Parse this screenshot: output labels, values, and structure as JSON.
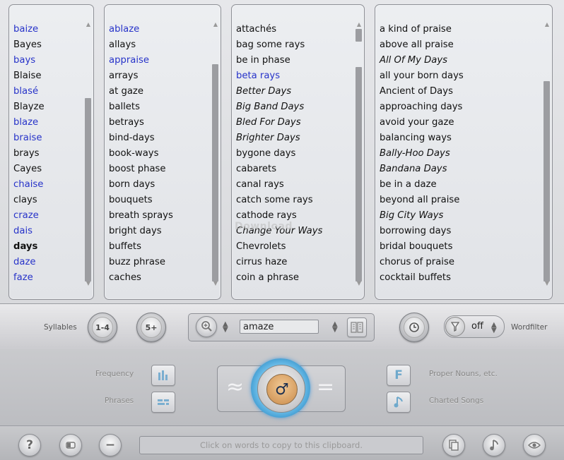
{
  "lists": [
    {
      "items": [
        {
          "text": "baize",
          "style": "blue"
        },
        {
          "text": "Bayes",
          "style": ""
        },
        {
          "text": "bays",
          "style": "blue"
        },
        {
          "text": "Blaise",
          "style": ""
        },
        {
          "text": "blasé",
          "style": "blue"
        },
        {
          "text": "Blayze",
          "style": ""
        },
        {
          "text": "blaze",
          "style": "blue"
        },
        {
          "text": "braise",
          "style": "blue"
        },
        {
          "text": "brays",
          "style": ""
        },
        {
          "text": "Cayes",
          "style": ""
        },
        {
          "text": "chaise",
          "style": "blue"
        },
        {
          "text": "clays",
          "style": ""
        },
        {
          "text": "craze",
          "style": "blue"
        },
        {
          "text": "dais",
          "style": "blue"
        },
        {
          "text": "days",
          "style": "bold"
        },
        {
          "text": "daze",
          "style": "blue"
        },
        {
          "text": "faze",
          "style": "blue"
        }
      ]
    },
    {
      "items": [
        {
          "text": "ablaze",
          "style": "blue"
        },
        {
          "text": "allays",
          "style": ""
        },
        {
          "text": "appraise",
          "style": "blue"
        },
        {
          "text": "arrays",
          "style": ""
        },
        {
          "text": "at gaze",
          "style": ""
        },
        {
          "text": "ballets",
          "style": ""
        },
        {
          "text": "betrays",
          "style": ""
        },
        {
          "text": "bind-days",
          "style": ""
        },
        {
          "text": "book-ways",
          "style": ""
        },
        {
          "text": "boost phase",
          "style": ""
        },
        {
          "text": "born days",
          "style": ""
        },
        {
          "text": "bouquets",
          "style": ""
        },
        {
          "text": "breath sprays",
          "style": ""
        },
        {
          "text": "bright days",
          "style": ""
        },
        {
          "text": "buffets",
          "style": ""
        },
        {
          "text": "buzz phrase",
          "style": ""
        },
        {
          "text": "caches",
          "style": ""
        }
      ]
    },
    {
      "items": [
        {
          "text": "attachés",
          "style": ""
        },
        {
          "text": "bag some rays",
          "style": ""
        },
        {
          "text": "be in phase",
          "style": ""
        },
        {
          "text": "beta rays",
          "style": "blue"
        },
        {
          "text": "Better Days",
          "style": "it"
        },
        {
          "text": "Big Band Days",
          "style": "it"
        },
        {
          "text": "Bled For Days",
          "style": "it"
        },
        {
          "text": "Brighter Days",
          "style": "it"
        },
        {
          "text": "bygone days",
          "style": ""
        },
        {
          "text": "cabarets",
          "style": ""
        },
        {
          "text": "canal rays",
          "style": ""
        },
        {
          "text": "catch some rays",
          "style": ""
        },
        {
          "text": "cathode rays",
          "style": ""
        },
        {
          "text": "Change Your Ways",
          "style": "it"
        },
        {
          "text": "Chevrolets",
          "style": ""
        },
        {
          "text": "cirrus haze",
          "style": ""
        },
        {
          "text": "coin a phrase",
          "style": ""
        }
      ]
    },
    {
      "items": [
        {
          "text": "a kind of praise",
          "style": ""
        },
        {
          "text": "above all praise",
          "style": ""
        },
        {
          "text": "All Of My Days",
          "style": "it"
        },
        {
          "text": "all your born days",
          "style": ""
        },
        {
          "text": "Ancient of Days",
          "style": ""
        },
        {
          "text": "approaching days",
          "style": ""
        },
        {
          "text": "avoid your gaze",
          "style": ""
        },
        {
          "text": "balancing ways",
          "style": ""
        },
        {
          "text": "Bally-Hoo Days",
          "style": "it"
        },
        {
          "text": "Bandana Days",
          "style": "it"
        },
        {
          "text": "be in a daze",
          "style": ""
        },
        {
          "text": "beyond all praise",
          "style": ""
        },
        {
          "text": "Big City Ways",
          "style": "it"
        },
        {
          "text": "borrowing days",
          "style": ""
        },
        {
          "text": "bridal bouquets",
          "style": ""
        },
        {
          "text": "chorus of praise",
          "style": ""
        },
        {
          "text": "cocktail buffets",
          "style": ""
        }
      ]
    }
  ],
  "toolbar": {
    "syllables_label": "Syllables",
    "syll_btn_1": "1-4",
    "syll_btn_2": "5+",
    "search_value": "amaze",
    "wordfilter_label": "Wordfilter",
    "wordfilter_value": "off"
  },
  "panel": {
    "frequency_label": "Frequency",
    "phrases_label": "Phrases",
    "proper_nouns_label": "Proper Nouns, etc.",
    "charted_songs_label": "Charted Songs",
    "approx_symbol": "≈",
    "equals_symbol": "=",
    "rhyme_symbol": "♂",
    "proper_nouns_icon_text": "F"
  },
  "footer": {
    "clipboard_placeholder": "Click on words to copy to this clipboard.",
    "help_icon_text": "?",
    "minus_icon_text": "−"
  },
  "watermark": "Download"
}
